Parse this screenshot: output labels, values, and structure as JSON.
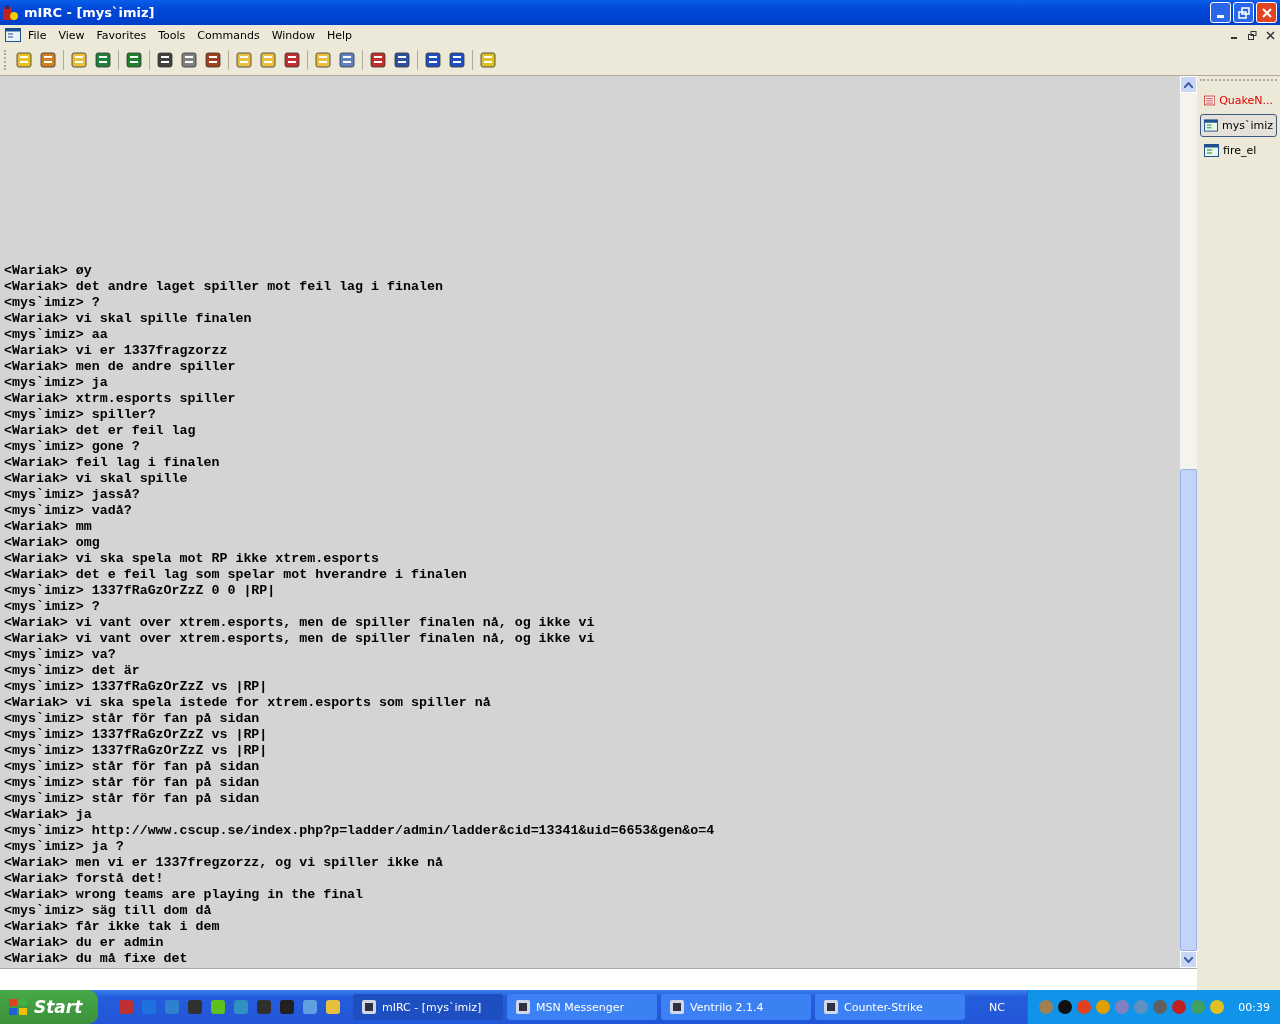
{
  "window": {
    "title": "mIRC - [mys`imiz]"
  },
  "menu": [
    "File",
    "View",
    "Favorites",
    "Tools",
    "Commands",
    "Window",
    "Help"
  ],
  "switchbar": [
    {
      "label": "QuakeN...",
      "kind": "status",
      "highlighted": true,
      "selected": false
    },
    {
      "label": "mys`imiz",
      "kind": "query",
      "highlighted": false,
      "selected": true
    },
    {
      "label": "fire_el",
      "kind": "query",
      "highlighted": false,
      "selected": false
    }
  ],
  "chat": [
    {
      "text": "<Wariak> øy"
    },
    {
      "text": "<Wariak> det andre laget spiller mot feil lag i finalen"
    },
    {
      "text": "<mys`imiz> ?"
    },
    {
      "text": "<Wariak> vi skal spille finalen"
    },
    {
      "text": "<mys`imiz> aa"
    },
    {
      "text": "<Wariak> vi er 1337fragzorzz"
    },
    {
      "text": "<Wariak> men de andre spiller"
    },
    {
      "text": "<mys`imiz> ja"
    },
    {
      "text": "<Wariak> xtrm.esports spiller"
    },
    {
      "text": "<mys`imiz> spiller?"
    },
    {
      "text": "<Wariak> det er feil lag"
    },
    {
      "text": "<mys`imiz> gone ?"
    },
    {
      "text": "<Wariak> feil lag i finalen"
    },
    {
      "text": "<Wariak> vi skal spille"
    },
    {
      "text": "<mys`imiz> jasså?"
    },
    {
      "text": "<mys`imiz> vadå?"
    },
    {
      "text": "<Wariak> mm"
    },
    {
      "text": "<Wariak> omg"
    },
    {
      "text": "<Wariak> vi ska spela mot RP ikke xtrem.esports"
    },
    {
      "text": "<Wariak> det e feil lag som spelar mot hverandre i finalen"
    },
    {
      "text": "<mys`imiz> 1337fRaGzOrZzZ 0 0 |RP|"
    },
    {
      "text": "<mys`imiz> ?"
    },
    {
      "text": "<Wariak> vi vant over xtrem.esports, men de spiller finalen nå, og ikke vi"
    },
    {
      "text": "<Wariak> vi vant over xtrem.esports, men de spiller finalen nå, og ikke vi"
    },
    {
      "text": "<mys`imiz> va?"
    },
    {
      "text": "<mys`imiz> det är"
    },
    {
      "text": "<mys`imiz> 1337fRaGzOrZzZ vs |RP|"
    },
    {
      "text": "<Wariak> vi ska spela istede for xtrem.esports som spiller nå"
    },
    {
      "text": "<mys`imiz> står för fan på sidan"
    },
    {
      "text": "<mys`imiz> 1337fRaGzOrZzZ vs |RP|"
    },
    {
      "text": "<mys`imiz> 1337fRaGzOrZzZ vs |RP|"
    },
    {
      "text": "<mys`imiz> står för fan på sidan"
    },
    {
      "text": "<mys`imiz> står för fan på sidan"
    },
    {
      "text": "<mys`imiz> står för fan på sidan"
    },
    {
      "text": "<Wariak> ja"
    },
    {
      "text": "<mys`imiz> http://www.cscup.se/index.php?p=ladder/admin/ladder&cid=13341&uid=6653&gen&o=4"
    },
    {
      "text": "<mys`imiz> ja ?"
    },
    {
      "text": "<Wariak> men vi er 1337fregzorzz, og vi spiller ikke nå"
    },
    {
      "text": "<Wariak> forstå det!"
    },
    {
      "text": "<Wariak> wrong teams are playing in the final"
    },
    {
      "text": "<mys`imiz> säg till dom då"
    },
    {
      "text": "<Wariak> får ikke tak i dem"
    },
    {
      "text": "<Wariak> du er admin"
    },
    {
      "text": "<Wariak> du må fixe det"
    }
  ],
  "taskbar": {
    "start": "Start",
    "tasks": [
      {
        "label": "mIRC - [mys`imiz]",
        "selected": true
      },
      {
        "label": "MSN Messenger",
        "selected": false
      },
      {
        "label": "Ventrilo 2.1.4",
        "selected": false
      },
      {
        "label": "Counter-Strike",
        "selected": false
      }
    ],
    "language": "NC",
    "clock": "00:39"
  }
}
